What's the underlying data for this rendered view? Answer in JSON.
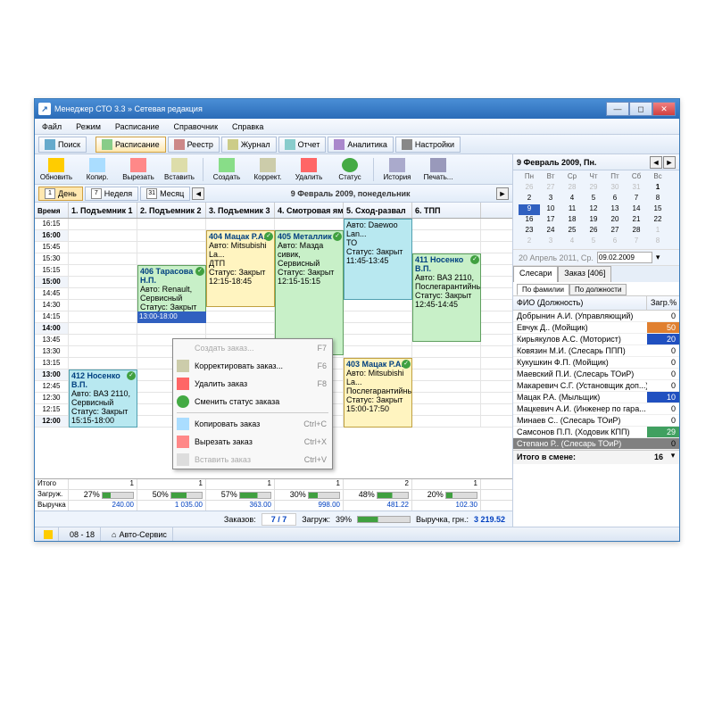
{
  "window": {
    "title": "Менеджер СТО 3.3 » Сетевая редакция"
  },
  "menu": [
    "Файл",
    "Режим",
    "Расписание",
    "Справочник",
    "Справка"
  ],
  "tb1": {
    "search": "Поиск",
    "items": [
      "Расписание",
      "Реестр",
      "Журнал",
      "Отчет",
      "Аналитика",
      "Настройки"
    ]
  },
  "tb2": [
    "Обновить",
    "Копир.",
    "Вырезать",
    "Вставить",
    "Создать",
    "Коррект.",
    "Удалить",
    "Статус",
    "История",
    "Печать..."
  ],
  "view": {
    "day": "День",
    "week": "Неделя",
    "month": "Месяц",
    "d": "1",
    "w": "7",
    "m": "31",
    "date": "9 Февраль 2009, понедельник"
  },
  "cols": [
    "Время",
    "1. Подъемник 1",
    "2. Подъемник 2",
    "3. Подъемник 3",
    "4. Смотровая яма",
    "5. Сход-развал",
    "6. ТПП"
  ],
  "times": [
    "12:00",
    "12:15",
    "12:30",
    "12:45",
    "13:00",
    "13:15",
    "13:30",
    "13:45",
    "14:00",
    "14:15",
    "14:30",
    "14:45",
    "15:00",
    "15:15",
    "15:30",
    "15:45",
    "16:00",
    "16:15"
  ],
  "selected_slot": "13:00-18:00",
  "apts": {
    "a1": {
      "title": "406 Тарасова Н.П.",
      "l1": "Авто: Renault,",
      "l2": "Сервисный",
      "l3": "Статус: Закрыт"
    },
    "a2": {
      "title": "404 Мацак Р.А.",
      "l1": "Авто: Mitsubishi La...",
      "l2": "ДТП",
      "l3": "Статус: Закрыт",
      "l4": "12:15-18:45"
    },
    "a3": {
      "title": "405 Металлик",
      "l1": "Авто: Мазда сивик,",
      "l2": "Сервисный",
      "l3": "Статус: Закрыт",
      "l4": "12:15-15:15"
    },
    "a4": {
      "title": "",
      "l1": "Авто: Daewoo Lan...",
      "l2": "ТО",
      "l3": "Статус: Закрыт",
      "l4": "11:45-13:45"
    },
    "a5": {
      "title": "411 Носенко В.П.",
      "l1": "Авто: ВАЗ 2110,",
      "l2": "Послегарантийный",
      "l3": "Статус: Закрыт",
      "l4": "12:45-14:45"
    },
    "a6": {
      "title": "412 Носенко В.П.",
      "l1": "Авто: ВАЗ 2110,",
      "l2": "Сервисный",
      "l3": "Статус: Закрыт",
      "l4": "15:15-18:00"
    },
    "a7": {
      "title": "403 Мацак Р.А.",
      "l1": "Авто: Mitsubishi La...",
      "l2": "Послегарантийный",
      "l3": "Статус: Закрыт",
      "l4": "15:00-17:50"
    }
  },
  "ctx": {
    "create": "Создать заказ...",
    "create_k": "F7",
    "edit": "Корректировать заказ...",
    "edit_k": "F6",
    "del": "Удалить заказ",
    "del_k": "F8",
    "status": "Сменить статус заказа",
    "copy": "Копировать заказ",
    "copy_k": "Ctrl+C",
    "cut": "Вырезать заказ",
    "cut_k": "Ctrl+X",
    "paste": "Вставить заказ",
    "paste_k": "Ctrl+V"
  },
  "foot": {
    "itogo": "Итого",
    "zagr": "Загруж.",
    "vyr": "Выручка",
    "counts": [
      "1",
      "1",
      "1",
      "1",
      "2",
      "1"
    ],
    "loads": [
      "27%",
      "50%",
      "57%",
      "30%",
      "48%",
      "20%"
    ],
    "loadp": [
      27,
      50,
      57,
      30,
      48,
      20
    ],
    "revs": [
      "240.00",
      "1 035.00",
      "363.00",
      "998.00",
      "481.22",
      "102.30"
    ]
  },
  "summary": {
    "orders_l": "Заказов:",
    "orders_v": "7 / 7",
    "load_l": "Загруж:",
    "load_v": "39%",
    "rev_l": "Выручка, грн.:",
    "rev_v": "3 219.52"
  },
  "status": {
    "hours": "08 - 18",
    "shop": "Авто-Сервис"
  },
  "cal": {
    "title": "9 Февраль 2009, Пн.",
    "days": [
      "Пн",
      "Вт",
      "Ср",
      "Чт",
      "Пт",
      "Сб",
      "Вс"
    ],
    "weeks": [
      [
        "26",
        "27",
        "28",
        "29",
        "30",
        "31",
        "1"
      ],
      [
        "2",
        "3",
        "4",
        "5",
        "6",
        "7",
        "8"
      ],
      [
        "9",
        "10",
        "11",
        "12",
        "13",
        "14",
        "15"
      ],
      [
        "16",
        "17",
        "18",
        "19",
        "20",
        "21",
        "22"
      ],
      [
        "23",
        "24",
        "25",
        "26",
        "27",
        "28",
        "1"
      ],
      [
        "2",
        "3",
        "4",
        "5",
        "6",
        "7",
        "8"
      ]
    ],
    "footer": "20 Апрель 2011, Ср.",
    "date_input": "09.02.2009"
  },
  "tabs": {
    "t1": "Слесари",
    "t2": "Заказ [406]",
    "s1": "По фамилии",
    "s2": "По должности"
  },
  "mech": {
    "h1": "ФИО (Должность)",
    "h2": "Загр.%",
    "rows": [
      {
        "n": "Добрынин А.И. (Управляющий)",
        "v": "0",
        "c": ""
      },
      {
        "n": "Евчук Д.. (Мойщик)",
        "v": "50",
        "c": "#e08030"
      },
      {
        "n": "Кирьякулов А.С. (Моторист)",
        "v": "20",
        "c": "#2050c0"
      },
      {
        "n": "Ковязин М.И. (Слесарь ППП)",
        "v": "0",
        "c": ""
      },
      {
        "n": "Кукушкин Ф.П. (Мойщик)",
        "v": "0",
        "c": ""
      },
      {
        "n": "Маевский П.И. (Слесарь ТОиР)",
        "v": "0",
        "c": ""
      },
      {
        "n": "Макаревич С.Г. (Установщик доп...)",
        "v": "0",
        "c": ""
      },
      {
        "n": "Мацак Р.А. (Мыльщик)",
        "v": "10",
        "c": "#2050c0"
      },
      {
        "n": "Мацкевич А.И. (Инженер по гара...",
        "v": "0",
        "c": ""
      },
      {
        "n": "Минаев С.. (Слесарь ТОиР)",
        "v": "0",
        "c": ""
      },
      {
        "n": "Самсонов П.П. (Ходовик КПП)",
        "v": "29",
        "c": "#40a060"
      },
      {
        "n": "Степано Р.. (Слесарь ТОиР)",
        "v": "0",
        "c": "",
        "sel": true
      }
    ],
    "foot_l": "Итого в смене:",
    "foot_v": "16"
  }
}
